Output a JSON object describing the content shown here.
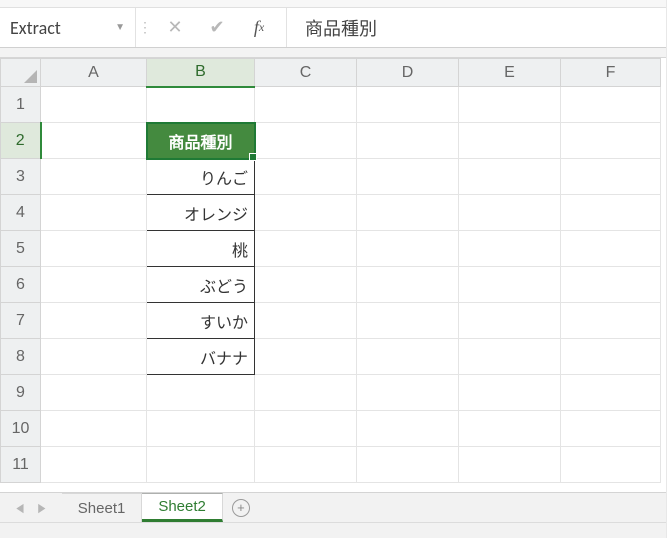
{
  "nameBox": "Extract",
  "formulaValue": "商品種別",
  "columns": [
    "A",
    "B",
    "C",
    "D",
    "E",
    "F"
  ],
  "rowCount": 11,
  "selectedCell": "B2",
  "table": {
    "header": "商品種別",
    "items": [
      "りんご",
      "オレンジ",
      "桃",
      "ぶどう",
      "すいか",
      "バナナ"
    ]
  },
  "sheets": [
    "Sheet1",
    "Sheet2"
  ],
  "activeSheet": "Sheet2",
  "chart_data": {
    "type": "table",
    "title": "商品種別",
    "categories": [
      "商品種別"
    ],
    "values": [
      "りんご",
      "オレンジ",
      "桃",
      "ぶどう",
      "すいか",
      "バナナ"
    ]
  }
}
